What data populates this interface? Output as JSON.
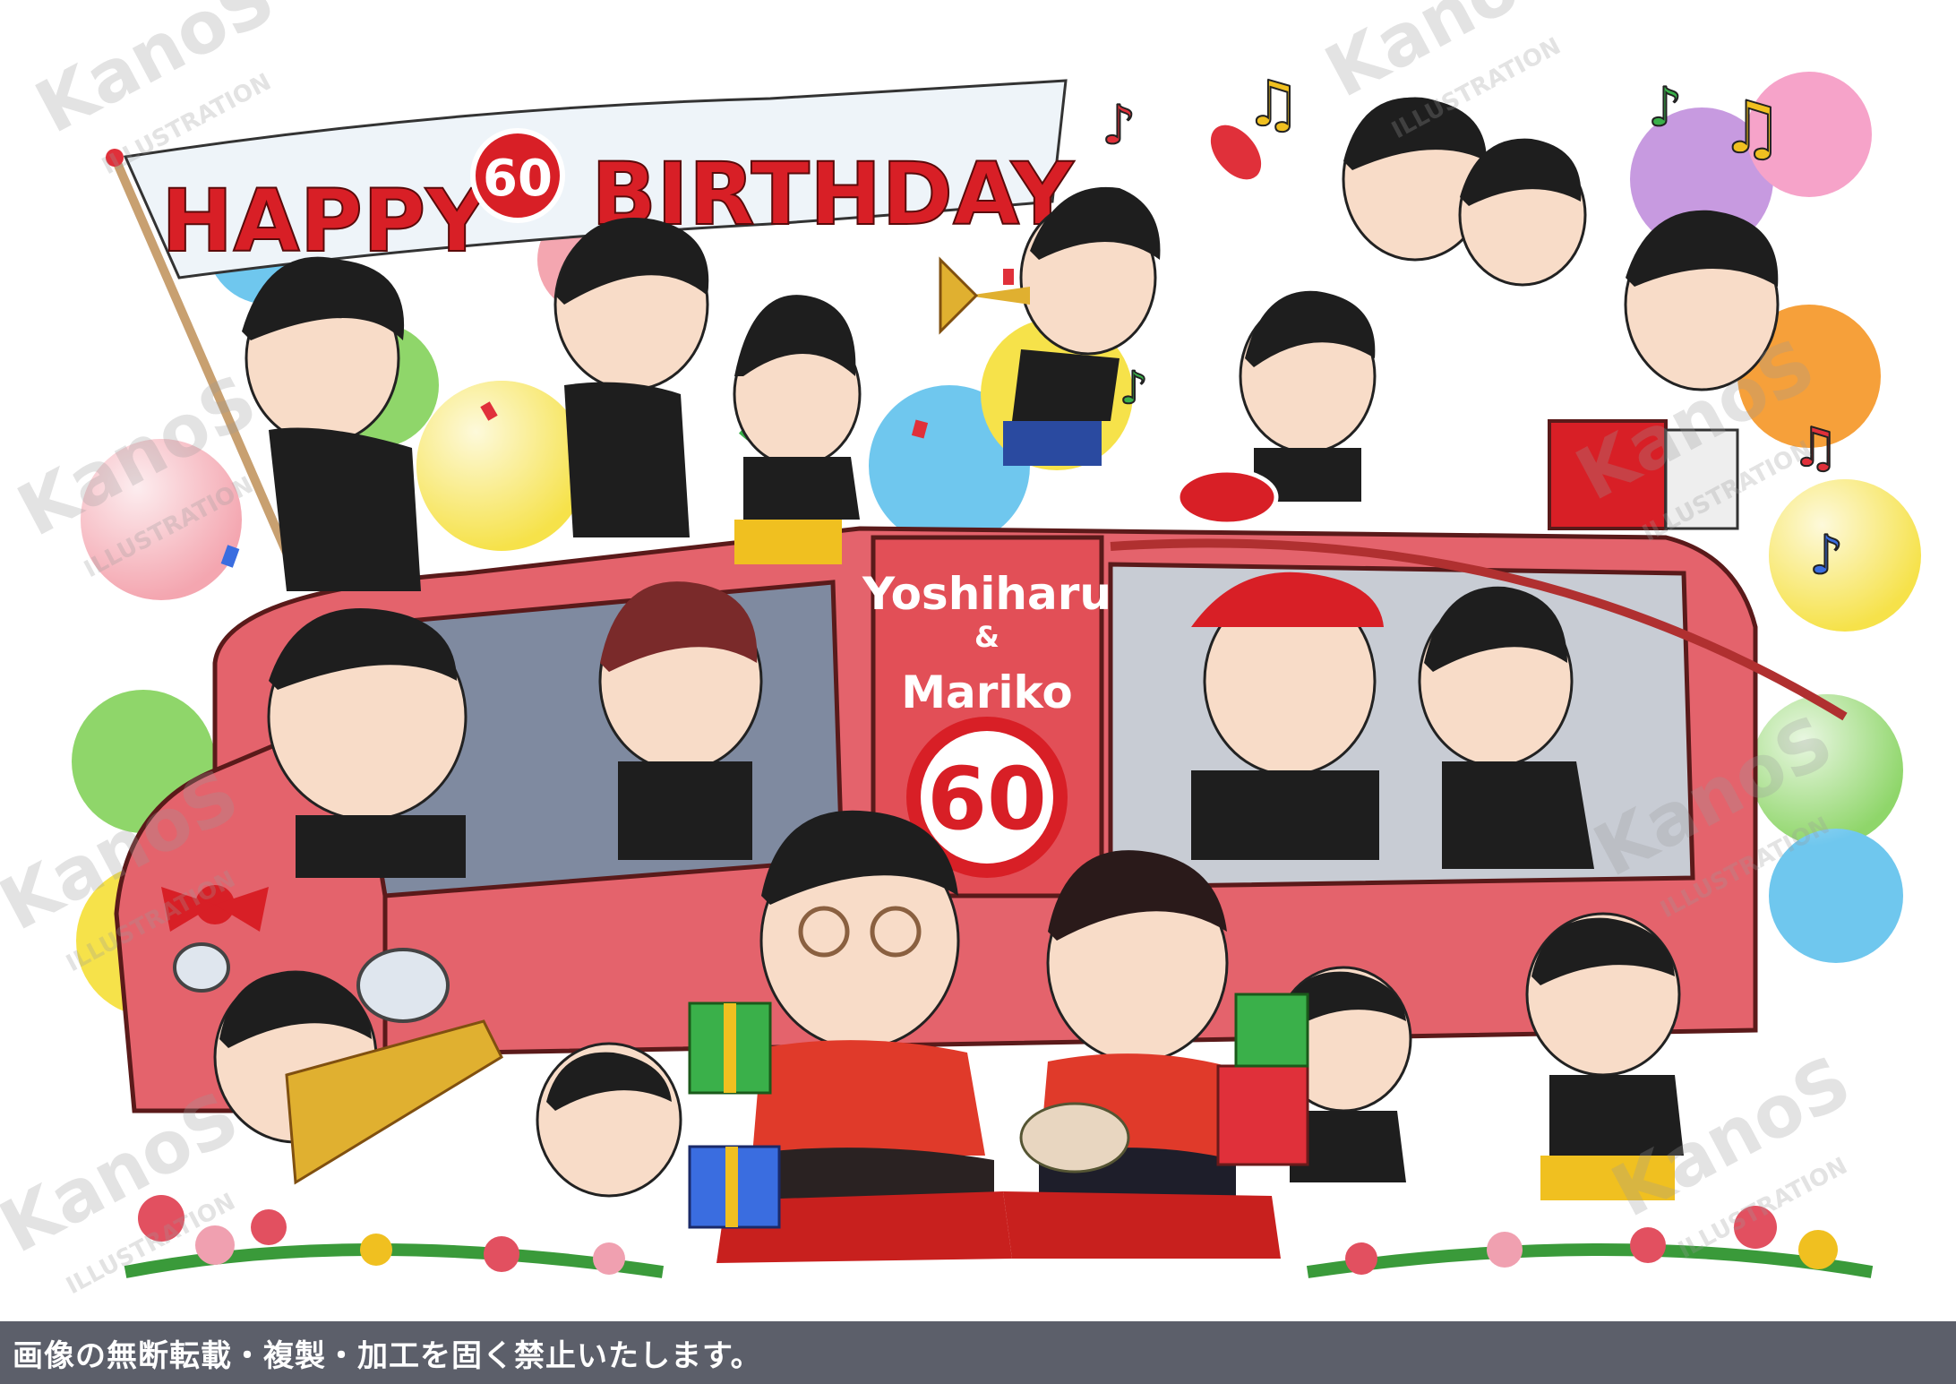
{
  "banner": {
    "happy": "HAPPY",
    "badge_number": "60",
    "birthday": "BIRTHDAY"
  },
  "sign": {
    "name1": "Yoshiharu",
    "amp": "&",
    "name2": "Mariko",
    "badge_number": "60"
  },
  "watermark": {
    "brand": "KanoS",
    "sub": "ILLUSTRATION"
  },
  "footer": {
    "notice": "画像の無断転載・複製・加工を固く禁止いたします。"
  },
  "colors": {
    "banner_red": "#d81f26",
    "van_pink": "#e4636c",
    "footer_bg": "#5c5f6a",
    "shirt_black": "#1e1e1e",
    "shirt_red": "#e03a2a"
  }
}
